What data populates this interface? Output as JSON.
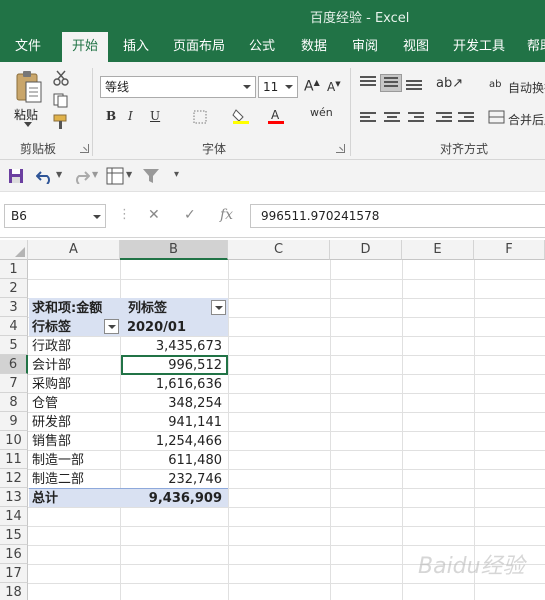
{
  "window": {
    "title": "百度经验  -  Excel"
  },
  "tabs": [
    {
      "label": "文件"
    },
    {
      "label": "开始"
    },
    {
      "label": "插入"
    },
    {
      "label": "页面布局"
    },
    {
      "label": "公式"
    },
    {
      "label": "数据"
    },
    {
      "label": "审阅"
    },
    {
      "label": "视图"
    },
    {
      "label": "开发工具"
    },
    {
      "label": "帮助"
    }
  ],
  "active_tab": "开始",
  "ribbon": {
    "clipboard": {
      "paste_label": "粘贴",
      "group_label": "剪贴板"
    },
    "font": {
      "font_name": "等线",
      "font_size": "11",
      "group_label": "字体",
      "bold": "B",
      "italic": "I",
      "underline": "U"
    },
    "alignment": {
      "wrap_text": "自动换行",
      "merge_center": "合并后居",
      "group_label": "对齐方式"
    }
  },
  "formula_bar": {
    "name_box": "B6",
    "fx": "fx",
    "formula": "996511.970241578"
  },
  "sheet": {
    "columns": [
      "A",
      "B",
      "C",
      "D",
      "E",
      "F"
    ],
    "rows": [
      "1",
      "2",
      "3",
      "4",
      "5",
      "6",
      "7",
      "8",
      "9",
      "10",
      "11",
      "12",
      "13",
      "14",
      "15",
      "16",
      "17",
      "18"
    ],
    "pivot": {
      "value_header": "求和项:金额",
      "col_header": "列标签",
      "row_header": "行标签",
      "period": "2020/01",
      "items": [
        {
          "dept": "行政部",
          "amount": "3,435,673"
        },
        {
          "dept": "会计部",
          "amount": "996,512"
        },
        {
          "dept": "采购部",
          "amount": "1,616,636"
        },
        {
          "dept": "仓管",
          "amount": "348,254"
        },
        {
          "dept": "研发部",
          "amount": "941,141"
        },
        {
          "dept": "销售部",
          "amount": "1,254,466"
        },
        {
          "dept": "制造一部",
          "amount": "611,480"
        },
        {
          "dept": "制造二部",
          "amount": "232,746"
        }
      ],
      "total_label": "总计",
      "total_amount": "9,436,909"
    }
  },
  "watermark": "Baidu经验",
  "colors": {
    "excel_green": "#217346",
    "pivot_header": "#d9e1f2",
    "selected_col_row": "#c6c6c6"
  }
}
